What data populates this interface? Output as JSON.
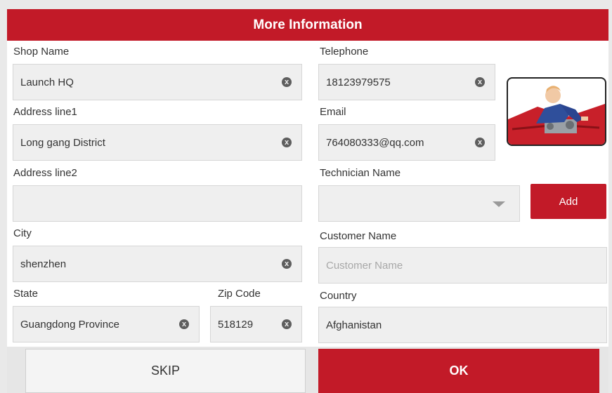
{
  "title": "More Information",
  "shop_name": {
    "label": "Shop Name",
    "value": "Launch HQ"
  },
  "address1": {
    "label": "Address line1",
    "value": "Long gang District"
  },
  "address2": {
    "label": "Address line2",
    "value": ""
  },
  "city": {
    "label": "City",
    "value": "shenzhen"
  },
  "state": {
    "label": "State",
    "value": "Guangdong Province"
  },
  "zip": {
    "label": "Zip Code",
    "value": "518129"
  },
  "telephone": {
    "label": "Telephone",
    "value": "18123979575"
  },
  "email": {
    "label": "Email",
    "value": "764080333@qq.com"
  },
  "technician": {
    "label": "Technician Name",
    "value": "",
    "add_label": "Add"
  },
  "customer": {
    "label": "Customer Name",
    "value": "",
    "placeholder": "Customer Name"
  },
  "country": {
    "label": "Country",
    "value": "Afghanistan"
  },
  "buttons": {
    "skip": "SKIP",
    "ok": "OK"
  },
  "clear_glyph": "x",
  "colors": {
    "accent": "#c21a28",
    "field_bg": "#efefef"
  },
  "icons": [
    "clear-icon",
    "dropdown-caret-icon",
    "mechanic-photo"
  ]
}
